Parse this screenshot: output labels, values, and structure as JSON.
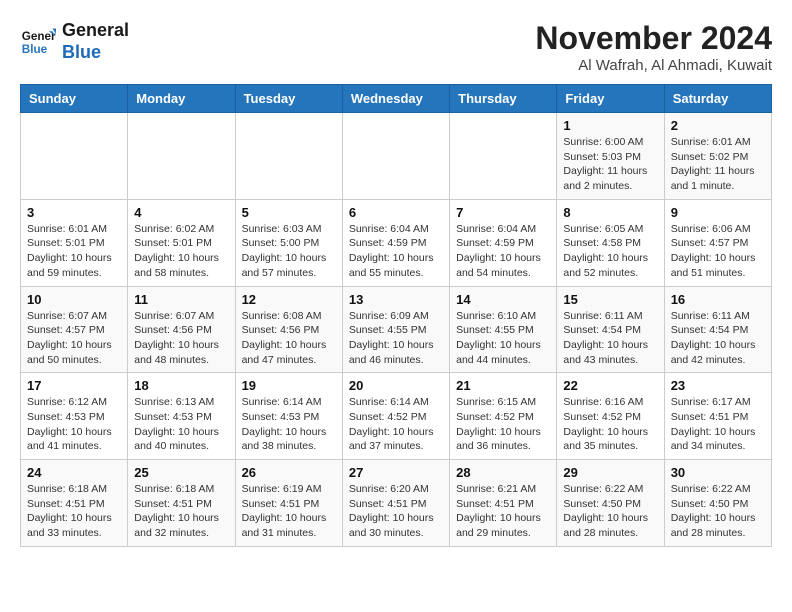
{
  "header": {
    "logo_general": "General",
    "logo_blue": "Blue",
    "month": "November 2024",
    "location": "Al Wafrah, Al Ahmadi, Kuwait"
  },
  "days_of_week": [
    "Sunday",
    "Monday",
    "Tuesday",
    "Wednesday",
    "Thursday",
    "Friday",
    "Saturday"
  ],
  "weeks": [
    [
      {
        "day": "",
        "info": ""
      },
      {
        "day": "",
        "info": ""
      },
      {
        "day": "",
        "info": ""
      },
      {
        "day": "",
        "info": ""
      },
      {
        "day": "",
        "info": ""
      },
      {
        "day": "1",
        "info": "Sunrise: 6:00 AM\nSunset: 5:03 PM\nDaylight: 11 hours and 2 minutes."
      },
      {
        "day": "2",
        "info": "Sunrise: 6:01 AM\nSunset: 5:02 PM\nDaylight: 11 hours and 1 minute."
      }
    ],
    [
      {
        "day": "3",
        "info": "Sunrise: 6:01 AM\nSunset: 5:01 PM\nDaylight: 10 hours and 59 minutes."
      },
      {
        "day": "4",
        "info": "Sunrise: 6:02 AM\nSunset: 5:01 PM\nDaylight: 10 hours and 58 minutes."
      },
      {
        "day": "5",
        "info": "Sunrise: 6:03 AM\nSunset: 5:00 PM\nDaylight: 10 hours and 57 minutes."
      },
      {
        "day": "6",
        "info": "Sunrise: 6:04 AM\nSunset: 4:59 PM\nDaylight: 10 hours and 55 minutes."
      },
      {
        "day": "7",
        "info": "Sunrise: 6:04 AM\nSunset: 4:59 PM\nDaylight: 10 hours and 54 minutes."
      },
      {
        "day": "8",
        "info": "Sunrise: 6:05 AM\nSunset: 4:58 PM\nDaylight: 10 hours and 52 minutes."
      },
      {
        "day": "9",
        "info": "Sunrise: 6:06 AM\nSunset: 4:57 PM\nDaylight: 10 hours and 51 minutes."
      }
    ],
    [
      {
        "day": "10",
        "info": "Sunrise: 6:07 AM\nSunset: 4:57 PM\nDaylight: 10 hours and 50 minutes."
      },
      {
        "day": "11",
        "info": "Sunrise: 6:07 AM\nSunset: 4:56 PM\nDaylight: 10 hours and 48 minutes."
      },
      {
        "day": "12",
        "info": "Sunrise: 6:08 AM\nSunset: 4:56 PM\nDaylight: 10 hours and 47 minutes."
      },
      {
        "day": "13",
        "info": "Sunrise: 6:09 AM\nSunset: 4:55 PM\nDaylight: 10 hours and 46 minutes."
      },
      {
        "day": "14",
        "info": "Sunrise: 6:10 AM\nSunset: 4:55 PM\nDaylight: 10 hours and 44 minutes."
      },
      {
        "day": "15",
        "info": "Sunrise: 6:11 AM\nSunset: 4:54 PM\nDaylight: 10 hours and 43 minutes."
      },
      {
        "day": "16",
        "info": "Sunrise: 6:11 AM\nSunset: 4:54 PM\nDaylight: 10 hours and 42 minutes."
      }
    ],
    [
      {
        "day": "17",
        "info": "Sunrise: 6:12 AM\nSunset: 4:53 PM\nDaylight: 10 hours and 41 minutes."
      },
      {
        "day": "18",
        "info": "Sunrise: 6:13 AM\nSunset: 4:53 PM\nDaylight: 10 hours and 40 minutes."
      },
      {
        "day": "19",
        "info": "Sunrise: 6:14 AM\nSunset: 4:53 PM\nDaylight: 10 hours and 38 minutes."
      },
      {
        "day": "20",
        "info": "Sunrise: 6:14 AM\nSunset: 4:52 PM\nDaylight: 10 hours and 37 minutes."
      },
      {
        "day": "21",
        "info": "Sunrise: 6:15 AM\nSunset: 4:52 PM\nDaylight: 10 hours and 36 minutes."
      },
      {
        "day": "22",
        "info": "Sunrise: 6:16 AM\nSunset: 4:52 PM\nDaylight: 10 hours and 35 minutes."
      },
      {
        "day": "23",
        "info": "Sunrise: 6:17 AM\nSunset: 4:51 PM\nDaylight: 10 hours and 34 minutes."
      }
    ],
    [
      {
        "day": "24",
        "info": "Sunrise: 6:18 AM\nSunset: 4:51 PM\nDaylight: 10 hours and 33 minutes."
      },
      {
        "day": "25",
        "info": "Sunrise: 6:18 AM\nSunset: 4:51 PM\nDaylight: 10 hours and 32 minutes."
      },
      {
        "day": "26",
        "info": "Sunrise: 6:19 AM\nSunset: 4:51 PM\nDaylight: 10 hours and 31 minutes."
      },
      {
        "day": "27",
        "info": "Sunrise: 6:20 AM\nSunset: 4:51 PM\nDaylight: 10 hours and 30 minutes."
      },
      {
        "day": "28",
        "info": "Sunrise: 6:21 AM\nSunset: 4:51 PM\nDaylight: 10 hours and 29 minutes."
      },
      {
        "day": "29",
        "info": "Sunrise: 6:22 AM\nSunset: 4:50 PM\nDaylight: 10 hours and 28 minutes."
      },
      {
        "day": "30",
        "info": "Sunrise: 6:22 AM\nSunset: 4:50 PM\nDaylight: 10 hours and 28 minutes."
      }
    ]
  ]
}
